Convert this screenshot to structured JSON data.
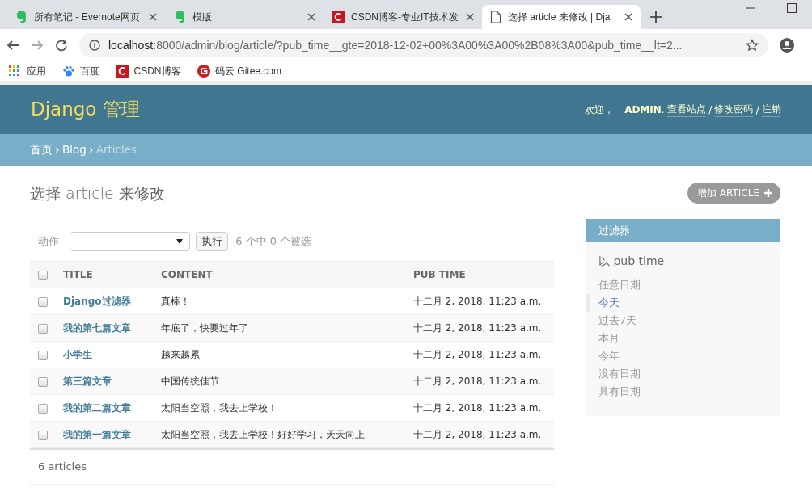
{
  "browser": {
    "tabs": [
      {
        "title": "所有笔记 - Evernote网页",
        "selected": false
      },
      {
        "title": "模版",
        "selected": false
      },
      {
        "title": "CSDN博客-专业IT技术发",
        "selected": false
      },
      {
        "title": "选择 article 来修改 | Dja",
        "selected": true
      }
    ],
    "address": {
      "host": "localhost",
      "rest": ":8000/admin/blog/article/?pub_time__gte=2018-12-02+00%3A00%3A00%2B08%3A00&pub_time__lt=2..."
    },
    "bookmarks": [
      {
        "label": "应用"
      },
      {
        "label": "百度"
      },
      {
        "label": "CSDN博客"
      },
      {
        "label": "码云 Gitee.com"
      }
    ]
  },
  "header": {
    "brand": "Django 管理",
    "welcome": "欢迎，",
    "user": "ADMIN",
    "user_suffix": ".",
    "links": [
      {
        "label": "查看站点"
      },
      {
        "separator": "/",
        "label": "修改密码"
      },
      {
        "separator": "/",
        "label": "注销"
      }
    ]
  },
  "breadcrumbs": [
    {
      "label": "首页",
      "kind": "link"
    },
    {
      "separator": "›",
      "label": "Blog",
      "kind": "link"
    },
    {
      "separator": "›",
      "label": "Articles",
      "kind": "current"
    }
  ],
  "page_title": "选择 article 来修改",
  "add_button": "增加 ARTICLE",
  "actions": {
    "label": "动作",
    "select_value": "---------",
    "go": "执行",
    "counter": "6 个中 0 个被选"
  },
  "table": {
    "columns": [
      "TITLE",
      "CONTENT",
      "PUB TIME"
    ],
    "select_all_checked": false,
    "rows": [
      {
        "title": "Django过滤器",
        "content": "真棒！",
        "pub_time": "十二月 2, 2018, 11:23 a.m.",
        "checked": false
      },
      {
        "title": "我的第七篇文章",
        "content": "年底了，快要过年了",
        "pub_time": "十二月 2, 2018, 11:23 a.m.",
        "checked": false
      },
      {
        "title": "小学生",
        "content": "越来越累",
        "pub_time": "十二月 2, 2018, 11:23 a.m.",
        "checked": false
      },
      {
        "title": "第三篇文章",
        "content": "中国传统佳节",
        "pub_time": "十二月 2, 2018, 11:23 a.m.",
        "checked": false
      },
      {
        "title": "我的第二篇文章",
        "content": "太阳当空照，我去上学校！",
        "pub_time": "十二月 2, 2018, 11:23 a.m.",
        "checked": false
      },
      {
        "title": "我的第一篇文章",
        "content": "太阳当空照，我去上学校！好好学习，天天向上",
        "pub_time": "十二月 2, 2018, 11:23 a.m.",
        "checked": false
      }
    ]
  },
  "paginator": "6 articles",
  "filter": {
    "title": "过滤器",
    "heading": "以 pub time",
    "options": [
      {
        "label": "任意日期",
        "selected": false
      },
      {
        "label": "今天",
        "selected": true
      },
      {
        "label": "过去7天",
        "selected": false
      },
      {
        "label": "本月",
        "selected": false
      },
      {
        "label": "今年",
        "selected": false
      },
      {
        "label": "没有日期",
        "selected": false
      },
      {
        "label": "具有日期",
        "selected": false
      }
    ]
  }
}
